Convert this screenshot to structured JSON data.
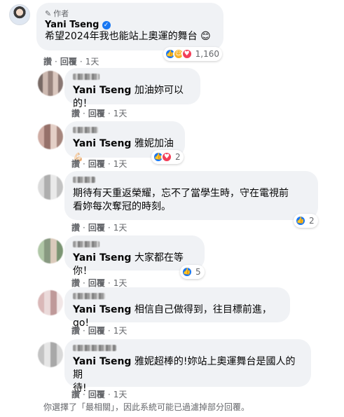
{
  "main_comment": {
    "author_tag": "作者",
    "name": "Yani Tseng",
    "text": "希望2024年我也能站上奧運的舞台",
    "emoji": "😊",
    "reaction_count": "1,160",
    "actions": {
      "like": "讚",
      "reply": "回覆",
      "time": "1天"
    }
  },
  "replies": [
    {
      "tag": "Yani Tseng",
      "text": "加油妳可以的！",
      "actions": {
        "like": "讚",
        "reply": "回覆",
        "time": "1天"
      }
    },
    {
      "tag": "Yani Tseng",
      "text": "雅妮加油",
      "emoji": "💪🏻",
      "reaction_count": "2",
      "actions": {
        "like": "讚",
        "reply": "回覆",
        "time": "1天"
      }
    },
    {
      "tag": "",
      "text_line1": "期待有天重返榮耀，忘不了當學生時，守在電視前",
      "text_line2": "看妳每次奪冠的時刻。",
      "reaction_count": "2",
      "actions": {
        "like": "讚",
        "reply": "回覆",
        "time": "1天"
      }
    },
    {
      "tag": "Yani Tseng",
      "text": "大家都在等你！",
      "reaction_count": "5",
      "actions": {
        "like": "讚",
        "reply": "回覆",
        "time": "1天"
      }
    },
    {
      "tag": "Yani Tseng",
      "text": "相信自己做得到，往目標前進，go!",
      "actions": {
        "like": "讚",
        "reply": "回覆",
        "time": "1天"
      }
    },
    {
      "tag": "Yani Tseng",
      "text_line1": "雅妮超棒的!妳站上奧運舞台是國人的期",
      "text_line2": "待!",
      "actions": {
        "like": "讚",
        "reply": "回覆",
        "time": "1天"
      }
    }
  ],
  "footer_note": "你選擇了「最相關」，因此系統可能已過濾掉部分回覆。",
  "colors": {
    "bubble": "#f0f2f5",
    "link_gray": "#65676b",
    "like_blue": "#1877f2",
    "love_red": "#f33e58",
    "care_yellow": "#f7b125"
  }
}
